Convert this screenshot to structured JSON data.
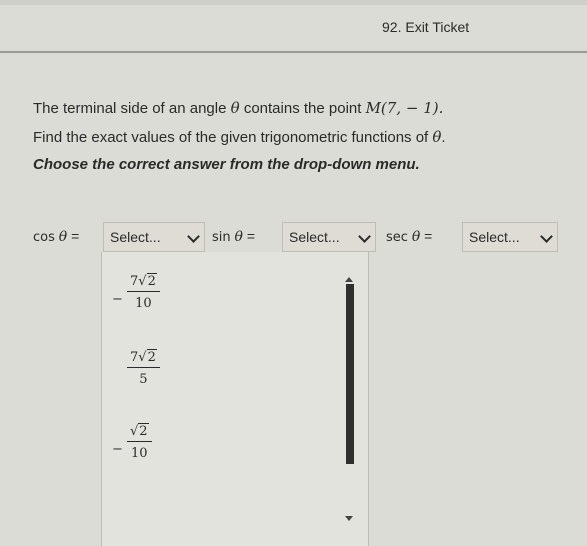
{
  "title": "92. Exit Ticket",
  "problem": {
    "line1_prefix": "The terminal side of an angle ",
    "theta": "θ",
    "line1_middle": " contains the point ",
    "point": "M(7, − 1).",
    "line2_prefix": "Find the exact values of the given trigonometric functions of ",
    "line2_suffix": ".",
    "instruction": "Choose the correct answer from the drop-down menu."
  },
  "questions": [
    {
      "fn": "cos",
      "theta": "θ",
      "eq": "=",
      "select_label": "Select..."
    },
    {
      "fn": "sin",
      "theta": "θ",
      "eq": "=",
      "select_label": "Select..."
    },
    {
      "fn": "sec",
      "theta": "θ",
      "eq": "=",
      "select_label": "Select..."
    }
  ],
  "dropdown_options": [
    {
      "sign": "−",
      "num_coef": "7",
      "radicand": "2",
      "den": "10"
    },
    {
      "sign": "",
      "num_coef": "7",
      "radicand": "2",
      "den": "5"
    },
    {
      "sign": "−",
      "num_coef": "",
      "radicand": "2",
      "den": "10"
    }
  ],
  "icons": {
    "select_chevron": "chevron-down-icon",
    "scroll_up": "triangle-up-icon",
    "scroll_down": "triangle-down-icon"
  }
}
